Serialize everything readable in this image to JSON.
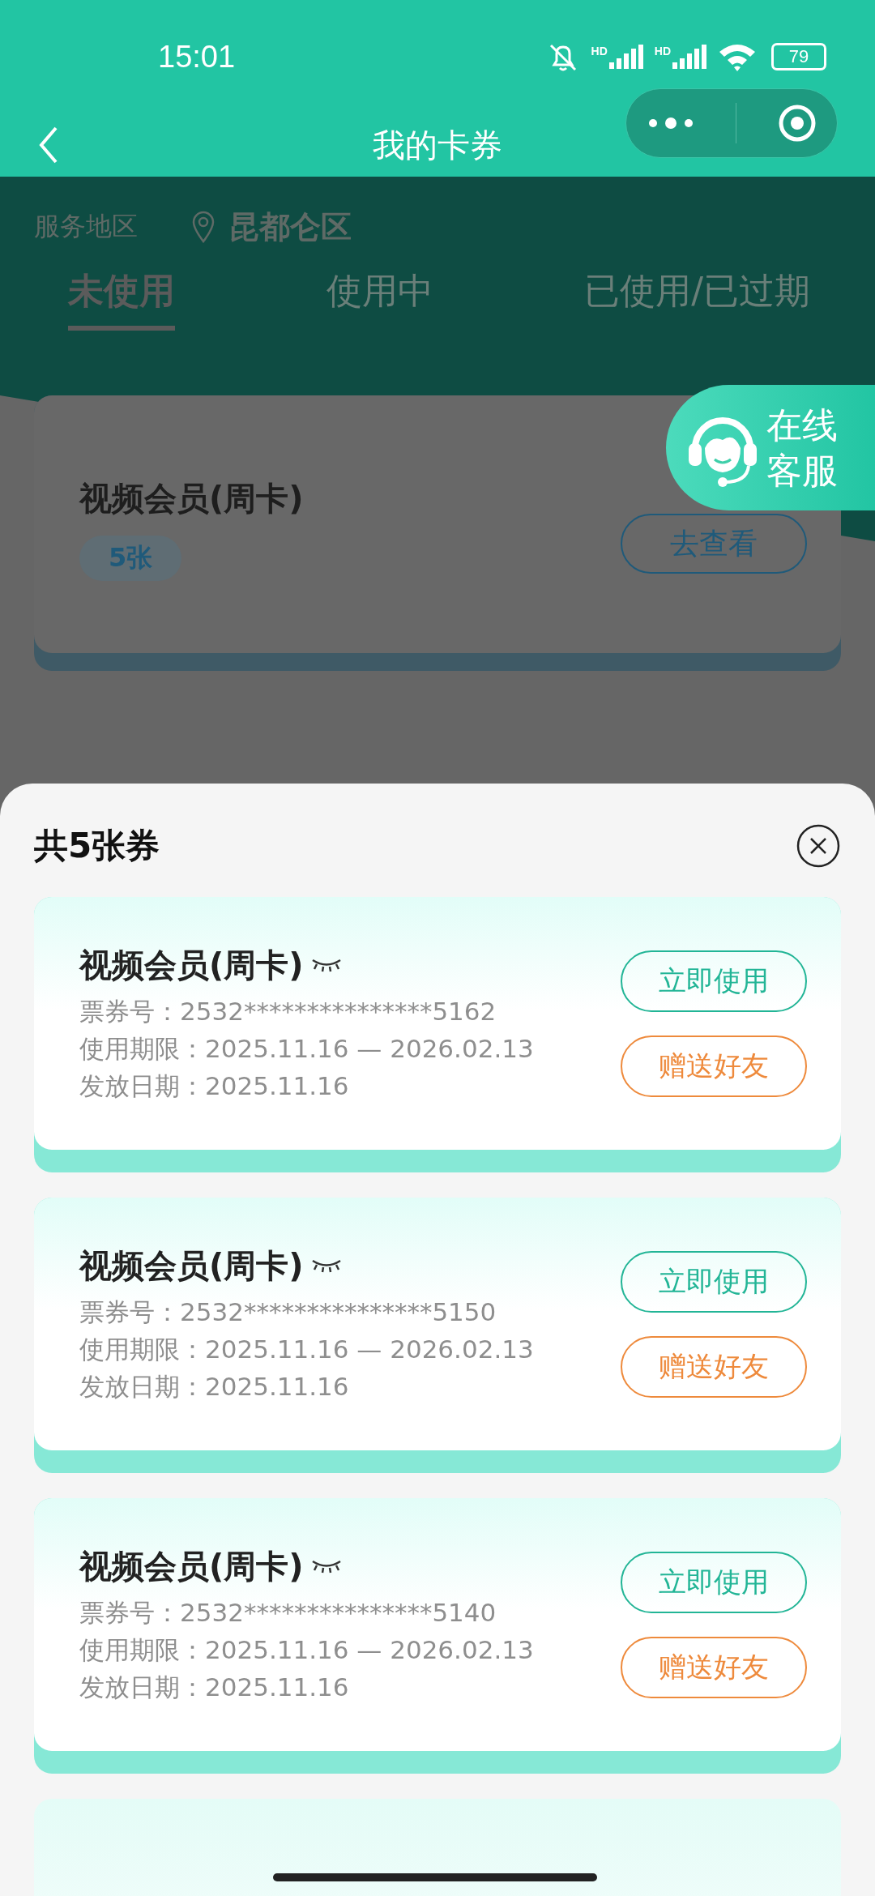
{
  "status_bar": {
    "time": "15:01",
    "signals": [
      {
        "label": "HD"
      },
      {
        "label": "HD"
      }
    ],
    "battery": "79"
  },
  "nav": {
    "title": "我的卡券"
  },
  "region": {
    "label": "服务地区",
    "value": "昆都仑区"
  },
  "tabs": [
    {
      "label": "未使用",
      "selected": true
    },
    {
      "label": "使用中",
      "selected": false
    },
    {
      "label": "已使用/已过期",
      "selected": false
    }
  ],
  "summary_card": {
    "title": "视频会员(周卡)",
    "count": "5张",
    "button": "去查看"
  },
  "support": {
    "line1": "在线",
    "line2": "客服"
  },
  "sheet": {
    "title": "共5张券",
    "coupons": [
      {
        "title": "视频会员(周卡)",
        "number": "票券号：2532***************5162",
        "validity": "使用期限：2025.11.16 — 2026.02.13",
        "issued": "发放日期：2025.11.16",
        "use_button": "立即使用",
        "gift_button": "赠送好友"
      },
      {
        "title": "视频会员(周卡)",
        "number": "票券号：2532***************5150",
        "validity": "使用期限：2025.11.16 — 2026.02.13",
        "issued": "发放日期：2025.11.16",
        "use_button": "立即使用",
        "gift_button": "赠送好友"
      },
      {
        "title": "视频会员(周卡)",
        "number": "票券号：2532***************5140",
        "validity": "使用期限：2025.11.16 — 2026.02.13",
        "issued": "发放日期：2025.11.16",
        "use_button": "立即使用",
        "gift_button": "赠送好友"
      }
    ]
  }
}
